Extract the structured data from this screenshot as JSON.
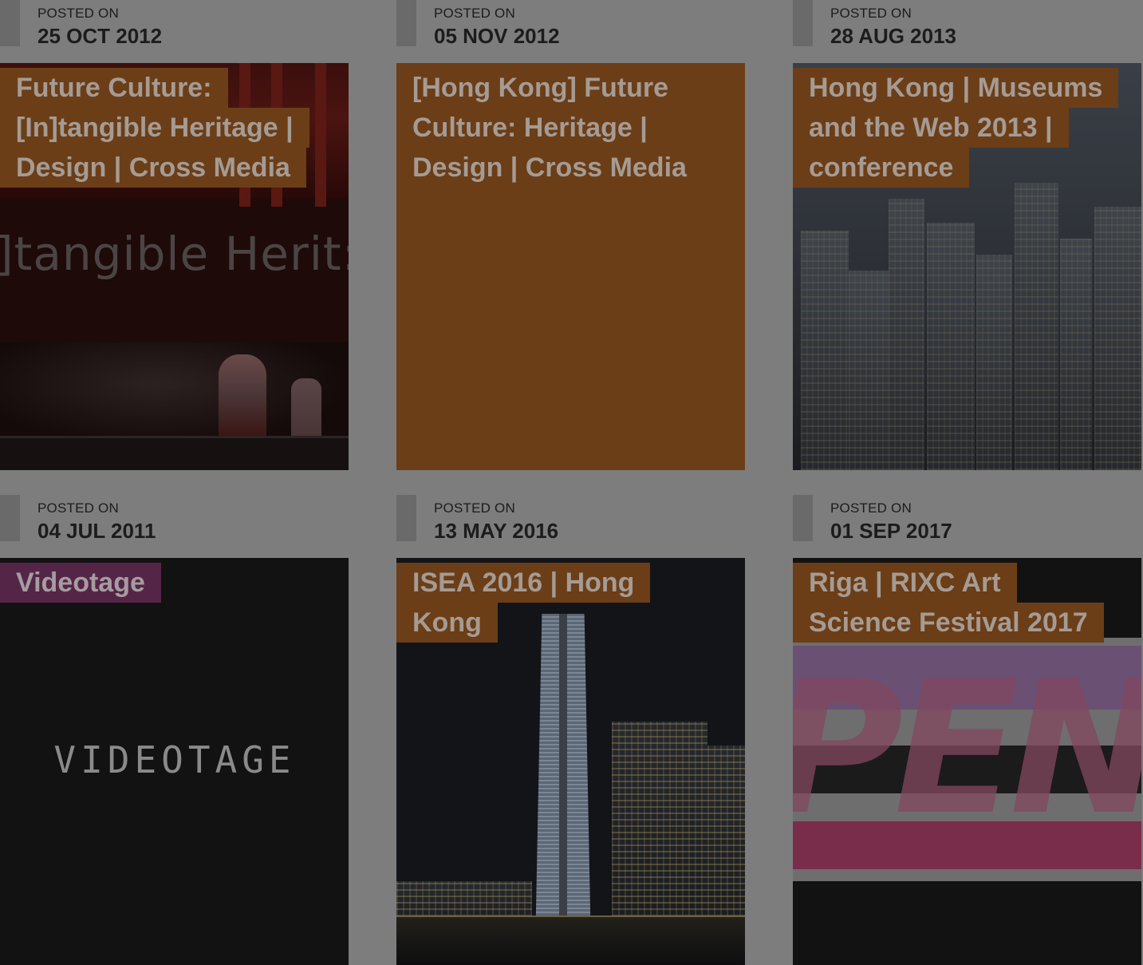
{
  "posted_label": "POSTED ON",
  "posts": [
    {
      "date": "25 OCT 2012",
      "title_lines": [
        "Future Culture:",
        "[In]tangible Heritage |",
        "Design | Cross Media"
      ],
      "image_text": "]tangible Herit:"
    },
    {
      "date": "05 NOV 2012",
      "title_lines": [
        "[Hong Kong] Future",
        "Culture: Heritage |",
        "Design | Cross Media"
      ]
    },
    {
      "date": "28 AUG 2013",
      "title_lines": [
        "Hong Kong | Museums",
        "and the Web 2013 |",
        "conference"
      ]
    },
    {
      "date": "04 JUL 2011",
      "title_lines": [
        "Videotage"
      ],
      "image_text": "VIDEOTAGE"
    },
    {
      "date": "13 MAY 2016",
      "title_lines": [
        "ISEA 2016 | Hong",
        "Kong"
      ]
    },
    {
      "date": "01 SEP 2017",
      "title_lines": [
        "Riga | RIXC Art",
        "Science Festival 2017"
      ],
      "image_text": "PEN"
    }
  ],
  "colors": {
    "overlay_gray": "#7d7d7d",
    "tag_orange": "#6b3e18",
    "tag_purple": "#552547",
    "title_text": "#a59b93",
    "date_text": "#1c1c1c"
  }
}
